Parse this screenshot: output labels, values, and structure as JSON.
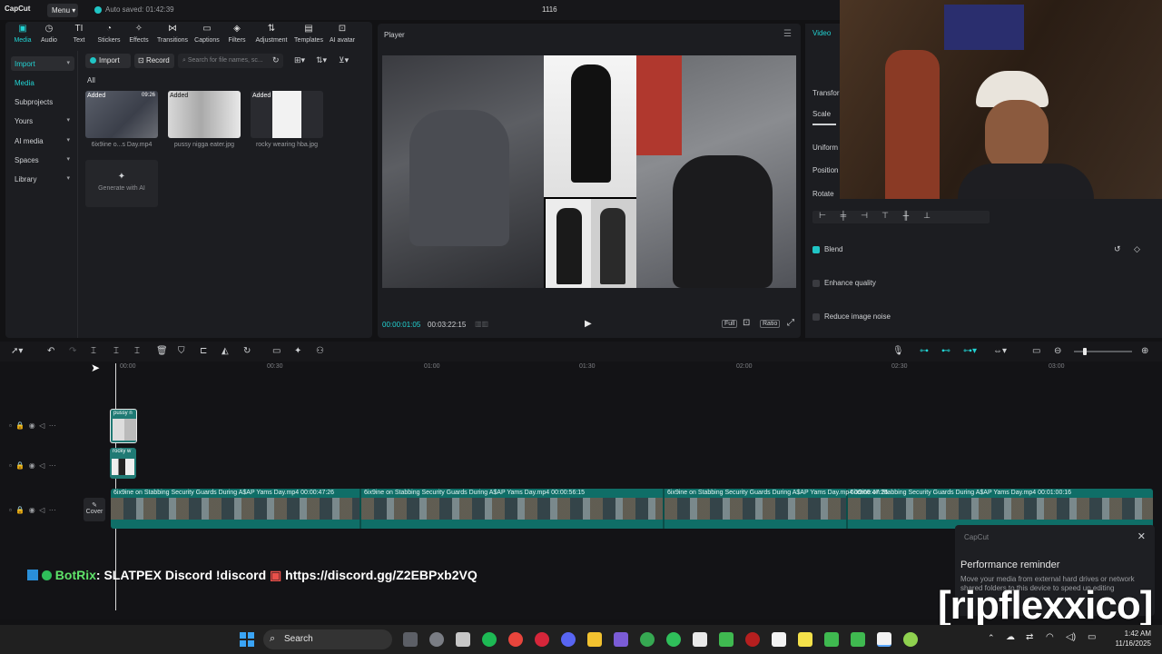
{
  "titlebar": {
    "logo": "CapCut",
    "menu": "Menu",
    "autosave": "Auto saved: 01:42:39",
    "project_title": "1116"
  },
  "toolbar_tabs": [
    {
      "label": "Media",
      "icon": "media-icon"
    },
    {
      "label": "Audio",
      "icon": "audio-icon"
    },
    {
      "label": "Text",
      "icon": "text-icon"
    },
    {
      "label": "Stickers",
      "icon": "stickers-icon"
    },
    {
      "label": "Effects",
      "icon": "effects-icon"
    },
    {
      "label": "Transitions",
      "icon": "transitions-icon"
    },
    {
      "label": "Captions",
      "icon": "captions-icon"
    },
    {
      "label": "Filters",
      "icon": "filters-icon"
    },
    {
      "label": "Adjustment",
      "icon": "adjustment-icon"
    },
    {
      "label": "Templates",
      "icon": "templates-icon"
    },
    {
      "label": "AI avatar",
      "icon": "ai-avatar-icon"
    }
  ],
  "sidebar": {
    "items": [
      "Import",
      "Media",
      "Subprojects",
      "Yours",
      "AI media",
      "Spaces",
      "Library"
    ]
  },
  "media": {
    "import_label": "Import",
    "record_label": "Record",
    "search_placeholder": "Search for file names, sc...",
    "filter_label": "All",
    "files": [
      {
        "tag": "Added",
        "duration": "09:26",
        "name": "6ix9ine o...s Day.mp4"
      },
      {
        "tag": "Added",
        "duration": "",
        "name": "pussy nigga eater.jpg"
      },
      {
        "tag": "Added",
        "duration": "",
        "name": "rocky wearing hba.jpg"
      }
    ],
    "generate_label": "Generate with AI"
  },
  "player": {
    "title": "Player",
    "time_current": "00:00:01:05",
    "time_total": "00:03:22:15",
    "btn_full": "Full",
    "btn_ratio": "Ratio"
  },
  "props": {
    "tab": "Video",
    "transform": "Transfor",
    "scale": "Scale",
    "uniform": "Uniform",
    "position": "Position",
    "rotate": "Rotate",
    "blend": "Blend",
    "enhance": "Enhance quality",
    "noise": "Reduce image noise"
  },
  "timeline": {
    "ticks": [
      "00:00",
      "00:30",
      "01:00",
      "01:30",
      "02:00",
      "02:30",
      "03:00"
    ],
    "clip1_label": "pussy n",
    "clip2_label": "rocky w",
    "cover_label": "Cover",
    "segments": [
      {
        "title": "6ix9ine on Stabbing Security Guards During A$AP Yams Day.mp4   00:00:47:26"
      },
      {
        "title": "6ix9ine on Stabbing Security Guards During A$AP Yams Day.mp4   00:00:56:15"
      },
      {
        "title": "6ix9ine on Stabbing Security Guards During A$AP Yams Day.mp4   00:00:47:26"
      },
      {
        "title": "6ix9ine on Stabbing Security Guards During A$AP Yams Day.mp4   00:01:00:16"
      }
    ]
  },
  "chat": {
    "bot": "BotRix",
    "message": ": SLATPEX Discord !discord",
    "link": "https://discord.gg/Z2EBPxb2VQ"
  },
  "perf": {
    "app": "CapCut",
    "title": "Performance reminder",
    "body": "Move your media from external hard drives or network shared folders to this device to speed up editing"
  },
  "watermark": "[ripflexxico]",
  "taskbar": {
    "search": "Search",
    "time": "1:42 AM",
    "date": "11/16/2025"
  },
  "colors": {
    "accent": "#22d3d3",
    "panel": "#1c1d21",
    "track": "#0f6e67"
  }
}
